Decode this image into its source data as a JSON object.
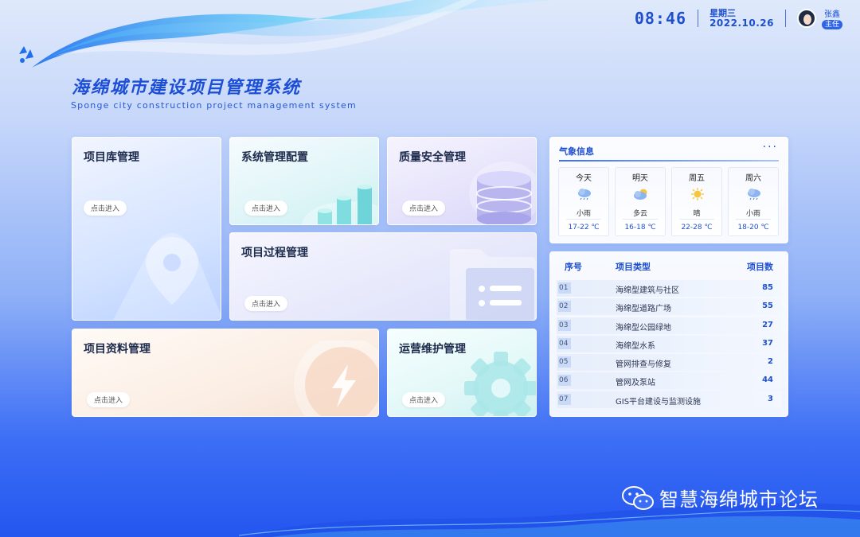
{
  "header": {
    "time": "08:46",
    "weekday": "星期三",
    "date": "2022.10.26",
    "user_name": "张鑫",
    "user_role": "主任"
  },
  "title": {
    "main": "海绵城市建设项目管理系统",
    "sub": "Sponge city construction project management system"
  },
  "cards": [
    {
      "title": "项目库管理",
      "enter": "点击进入"
    },
    {
      "title": "系统管理配置",
      "enter": "点击进入"
    },
    {
      "title": "质量安全管理",
      "enter": "点击进入"
    },
    {
      "title": "项目过程管理",
      "enter": "点击进入"
    },
    {
      "title": "项目资料管理",
      "enter": "点击进入"
    },
    {
      "title": "运营维护管理",
      "enter": "点击进入"
    }
  ],
  "weather": {
    "title": "气象信息",
    "more": "···",
    "days": [
      {
        "day": "今天",
        "condition": "小雨",
        "temp": "17-22 ℃",
        "icon": "rain-icon"
      },
      {
        "day": "明天",
        "condition": "多云",
        "temp": "16-18 ℃",
        "icon": "partly-cloudy-icon"
      },
      {
        "day": "周五",
        "condition": "晴",
        "temp": "22-28 ℃",
        "icon": "sun-icon"
      },
      {
        "day": "周六",
        "condition": "小雨",
        "temp": "18-20 ℃",
        "icon": "rain-icon"
      }
    ]
  },
  "project_table": {
    "headers": {
      "no": "序号",
      "type": "项目类型",
      "count": "项目数"
    },
    "rows": [
      {
        "no": "01",
        "type": "海绵型建筑与社区",
        "count": "85"
      },
      {
        "no": "02",
        "type": "海绵型道路广场",
        "count": "55"
      },
      {
        "no": "03",
        "type": "海绵型公园绿地",
        "count": "27"
      },
      {
        "no": "04",
        "type": "海绵型水系",
        "count": "37"
      },
      {
        "no": "05",
        "type": "管网排查与修复",
        "count": "2"
      },
      {
        "no": "06",
        "type": "管网及泵站",
        "count": "44"
      },
      {
        "no": "07",
        "type": "GIS平台建设与监测设施",
        "count": "3"
      }
    ]
  },
  "watermark": {
    "text": "智慧海绵城市论坛",
    "icon": "wechat-icon"
  },
  "colors": {
    "accent": "#1e4fcf",
    "background_bottom": "#2456f0"
  }
}
